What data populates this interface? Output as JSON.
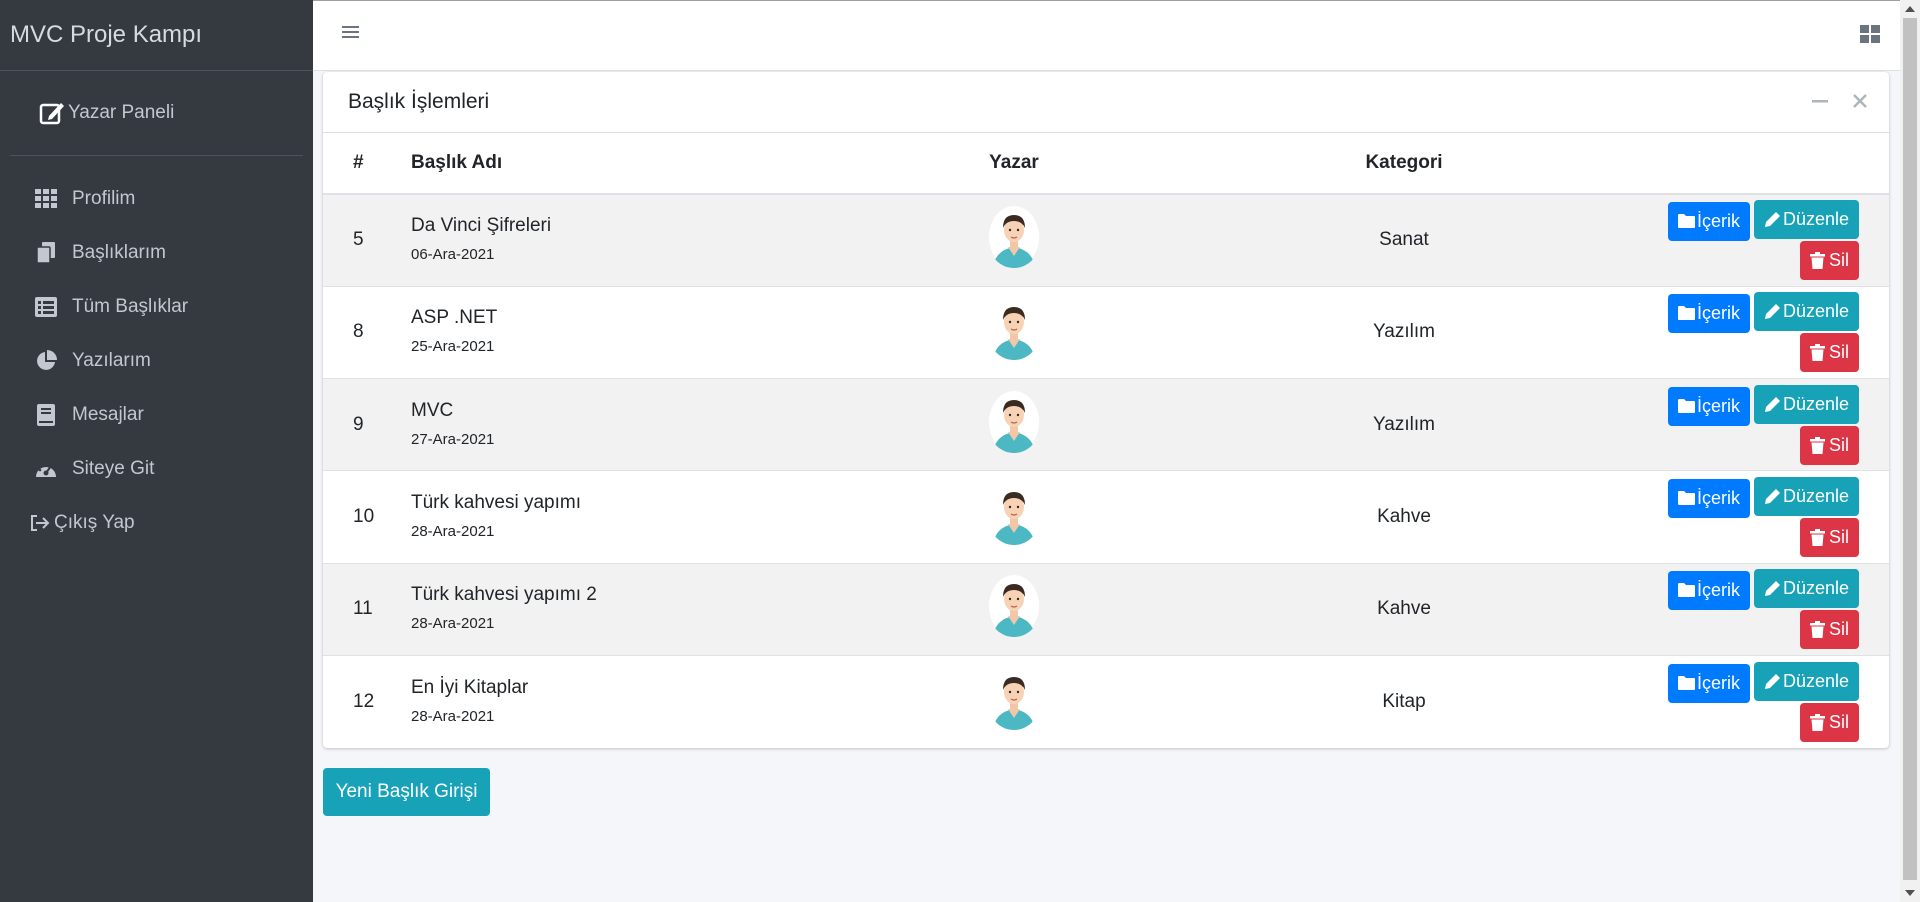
{
  "sidebar": {
    "brand": "MVC Proje Kampı",
    "user_panel": "Yazar Paneli",
    "items": [
      {
        "label": "Profilim",
        "icon": "grid-icon"
      },
      {
        "label": "Başlıklarım",
        "icon": "copy-icon"
      },
      {
        "label": "Tüm Başlıklar",
        "icon": "list-icon"
      },
      {
        "label": "Yazılarım",
        "icon": "pie-chart-icon"
      },
      {
        "label": "Mesajlar",
        "icon": "book-icon"
      },
      {
        "label": "Siteye Git",
        "icon": "gauge-icon"
      },
      {
        "label": "Çıkış Yap",
        "icon": "sign-out-icon"
      }
    ]
  },
  "card": {
    "title": "Başlık İşlemleri",
    "columns": [
      "#",
      "Başlık Adı",
      "Yazar",
      "Kategori"
    ],
    "rows": [
      {
        "id": "5",
        "title": "Da Vinci Şifreleri",
        "date": "06-Ara-2021",
        "category": "Sanat"
      },
      {
        "id": "8",
        "title": "ASP .NET",
        "date": "25-Ara-2021",
        "category": "Yazılım"
      },
      {
        "id": "9",
        "title": "MVC",
        "date": "27-Ara-2021",
        "category": "Yazılım"
      },
      {
        "id": "10",
        "title": "Türk kahvesi yapımı",
        "date": "28-Ara-2021",
        "category": "Kahve"
      },
      {
        "id": "11",
        "title": "Türk kahvesi yapımı 2",
        "date": "28-Ara-2021",
        "category": "Kahve"
      },
      {
        "id": "12",
        "title": "En İyi Kitaplar",
        "date": "28-Ara-2021",
        "category": "Kitap"
      }
    ],
    "actions": {
      "content": "İçerik",
      "edit": "Düzenle",
      "delete": "Sil"
    }
  },
  "new_button": "Yeni Başlık Girişi",
  "colors": {
    "sidebar": "#343a40",
    "primary": "#007bff",
    "info": "#17a2b8",
    "danger": "#dc3545"
  }
}
